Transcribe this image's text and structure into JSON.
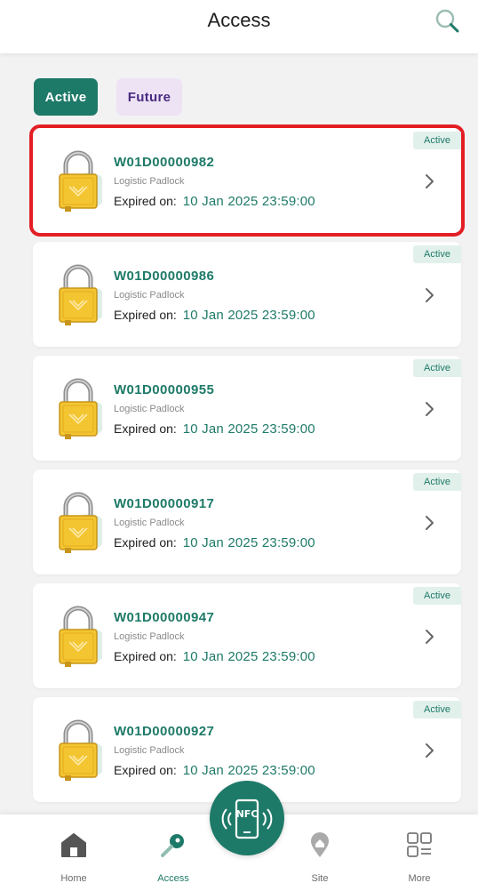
{
  "header": {
    "title": "Access"
  },
  "tabs": [
    {
      "label": "Active",
      "selected": true
    },
    {
      "label": "Future",
      "selected": false
    }
  ],
  "cards": [
    {
      "code": "W01D00000982",
      "type": "Logistic Padlock",
      "expiry_label": "Expired on:",
      "expiry_date": "10 Jan 2025 23:59:00",
      "status": "Active",
      "highlighted": true
    },
    {
      "code": "W01D00000986",
      "type": "Logistic Padlock",
      "expiry_label": "Expired on:",
      "expiry_date": "10 Jan 2025 23:59:00",
      "status": "Active"
    },
    {
      "code": "W01D00000955",
      "type": "Logistic Padlock",
      "expiry_label": "Expired on:",
      "expiry_date": "10 Jan 2025 23:59:00",
      "status": "Active"
    },
    {
      "code": "W01D00000917",
      "type": "Logistic Padlock",
      "expiry_label": "Expired on:",
      "expiry_date": "10 Jan 2025 23:59:00",
      "status": "Active"
    },
    {
      "code": "W01D00000947",
      "type": "Logistic Padlock",
      "expiry_label": "Expired on:",
      "expiry_date": "10 Jan 2025 23:59:00",
      "status": "Active"
    },
    {
      "code": "W01D00000927",
      "type": "Logistic Padlock",
      "expiry_label": "Expired on:",
      "expiry_date": "10 Jan 2025 23:59:00",
      "status": "Active"
    }
  ],
  "nfc": {
    "label": "NFC"
  },
  "nav": [
    {
      "label": "Home",
      "icon": "home-icon"
    },
    {
      "label": "Access",
      "icon": "key-icon",
      "current": true
    },
    {
      "label": "Site",
      "icon": "location-pin-icon"
    },
    {
      "label": "More",
      "icon": "grid-icon"
    }
  ],
  "colors": {
    "brand": "#1e7a68",
    "future_bg": "#ede3f4",
    "future_text": "#4a2a82",
    "highlight": "#e31e24",
    "padlock": "#f3c531"
  }
}
